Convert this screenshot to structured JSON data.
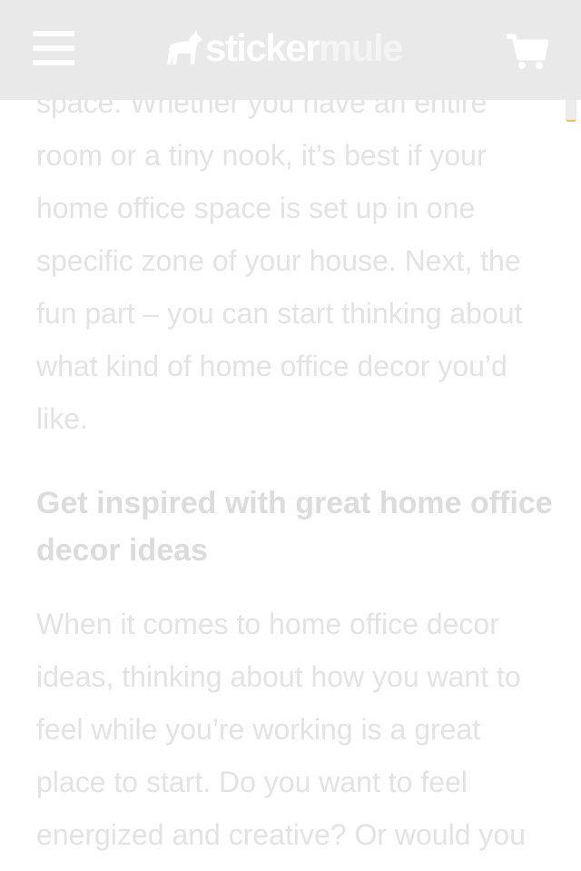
{
  "header": {
    "menu_icon": "hamburger-menu-icon",
    "logo_text_primary": "sticker",
    "logo_text_secondary": "mule",
    "logo_icon": "mule-logo-icon",
    "cart_icon": "shopping-cart-icon"
  },
  "article": {
    "paragraph_1": "space. Whether you have an entire room or a tiny nook, it’s best if your home office space is set up in one specific zone of your house. Next, the fun part – you can start thinking about what kind of home office decor you’d like.",
    "heading_1": "Get inspired with great home office decor ideas",
    "paragraph_2": "When it comes to home office decor ideas, thinking about how you want to feel while you’re working is a great place to start. Do you want to feel energized and creative? Or would you prefer a"
  },
  "colors": {
    "header_bg": "#e9e9e9",
    "text": "#e3e3e3",
    "scroll_accent": "#f5c24a"
  }
}
